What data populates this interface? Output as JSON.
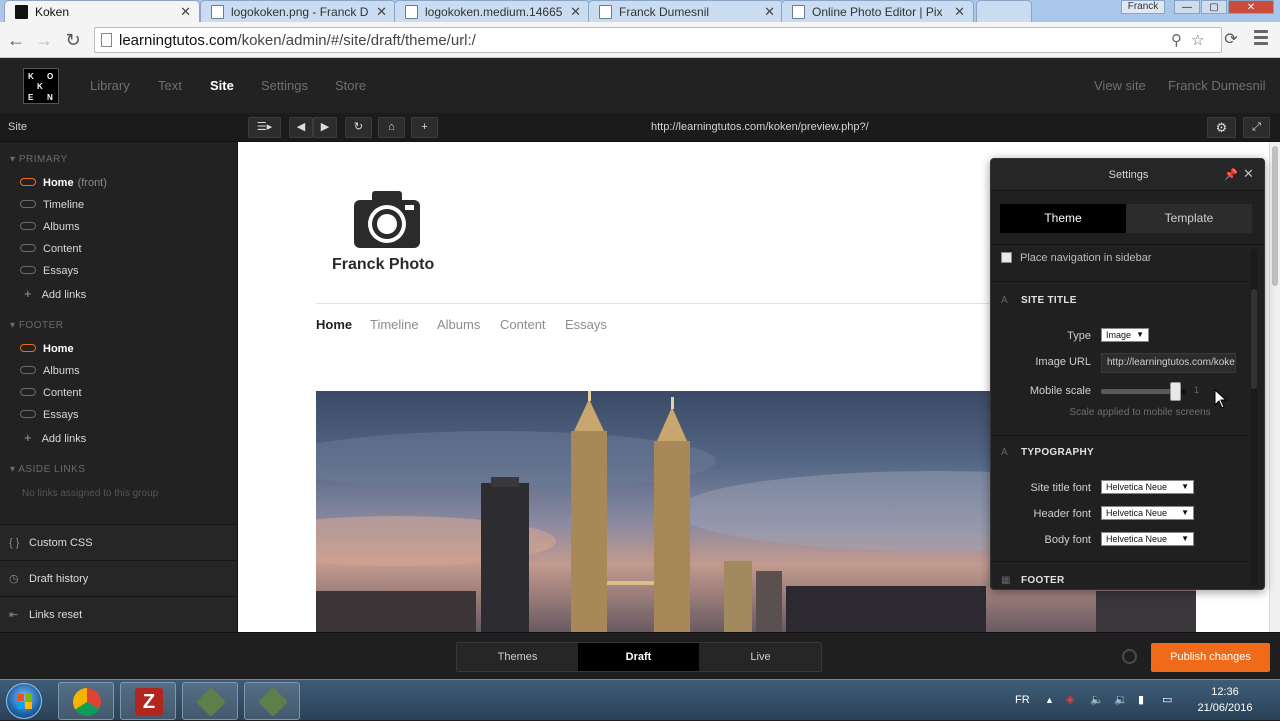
{
  "browser": {
    "tabs": [
      {
        "label": "Koken",
        "active": true
      },
      {
        "label": "logokoken.png - Franck D",
        "active": false
      },
      {
        "label": "logokoken.medium.14665",
        "active": false
      },
      {
        "label": "Franck Dumesnil",
        "active": false
      },
      {
        "label": "Online Photo Editor | Pix",
        "active": false
      }
    ],
    "user": "Franck",
    "url": {
      "host": "learningtutos.com",
      "path": "/koken/admin/#/site/draft/theme/url:/"
    }
  },
  "koken": {
    "nav": [
      "Library",
      "Text",
      "Site",
      "Settings",
      "Store"
    ],
    "active_nav": "Site",
    "right_links": {
      "view_site": "View site",
      "user": "Franck Dumesnil"
    },
    "logo_letters": [
      "K",
      "O",
      "K",
      "E",
      "N"
    ]
  },
  "subbar": {
    "section_title": "Site",
    "preview_url": "http://learningtutos.com/koken/preview.php?/"
  },
  "sidebar": {
    "primary": {
      "heading": "PRIMARY",
      "items": [
        {
          "label": "Home",
          "suffix": "(front)",
          "active": true
        },
        {
          "label": "Timeline"
        },
        {
          "label": "Albums"
        },
        {
          "label": "Content"
        },
        {
          "label": "Essays"
        }
      ],
      "add_label": "Add links"
    },
    "footer": {
      "heading": "FOOTER",
      "items": [
        {
          "label": "Home",
          "active": true
        },
        {
          "label": "Albums"
        },
        {
          "label": "Content"
        },
        {
          "label": "Essays"
        }
      ],
      "add_label": "Add links"
    },
    "aside": {
      "heading": "ASIDE LINKS",
      "empty_note": "No links assigned to this group"
    },
    "footer_actions": [
      "Custom CSS",
      "Draft history",
      "Links reset"
    ]
  },
  "preview": {
    "brand": "Franck Photo",
    "nav": [
      "Home",
      "Timeline",
      "Albums",
      "Content",
      "Essays"
    ],
    "active_nav": "Home"
  },
  "settings_panel": {
    "title": "Settings",
    "tabs": [
      "Theme",
      "Template"
    ],
    "active_tab": "Theme",
    "checkbox_label": "Place navigation in sidebar",
    "site_title": {
      "heading": "SITE TITLE",
      "type_label": "Type",
      "type_value": "Image",
      "image_url_label": "Image URL",
      "image_url_value": "http://learningtutos.com/koken",
      "mobile_scale_label": "Mobile scale",
      "mobile_scale_value": "1",
      "mobile_scale_fraction": 0.88,
      "hint": "Scale applied to mobile screens"
    },
    "typography": {
      "heading": "TYPOGRAPHY",
      "site_title_font_label": "Site title font",
      "site_title_font": "Helvetica Neue",
      "header_font_label": "Header font",
      "header_font": "Helvetica Neue",
      "body_font_label": "Body font",
      "body_font": "Helvetica Neue"
    },
    "footer_heading": "FOOTER"
  },
  "bottombar": {
    "modes": [
      "Themes",
      "Draft",
      "Live"
    ],
    "active_mode": "Draft",
    "publish_label": "Publish changes"
  },
  "taskbar": {
    "lang": "FR",
    "time": "12:36",
    "date": "21/06/2016"
  },
  "colors": {
    "accent": "#ef6b1a",
    "header_bg": "#222222",
    "panel_bg": "#202020"
  }
}
